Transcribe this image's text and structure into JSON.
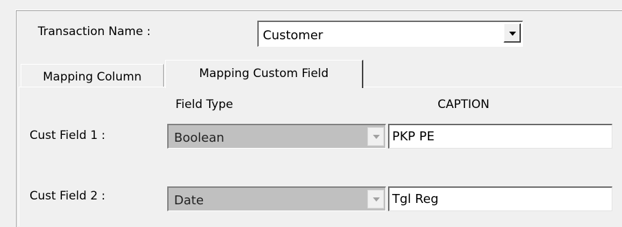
{
  "header": {
    "transaction_label": "Transaction Name :",
    "transaction_value": "Customer"
  },
  "tabs": [
    {
      "label": "Mapping Column",
      "active": false
    },
    {
      "label": "Mapping Custom Field",
      "active": true
    }
  ],
  "columns": {
    "field_type": "Field Type",
    "caption": "CAPTION"
  },
  "rows": [
    {
      "label": "Cust Field 1 :",
      "field_type": "Boolean",
      "caption": "PKP PE"
    },
    {
      "label": "Cust Field 2 :",
      "field_type": "Date",
      "caption": "Tgl Reg"
    }
  ],
  "colors": {
    "window_bg": "#f0f0f0",
    "disabled_bg": "#c0c0c0",
    "input_bg": "#ffffff"
  }
}
